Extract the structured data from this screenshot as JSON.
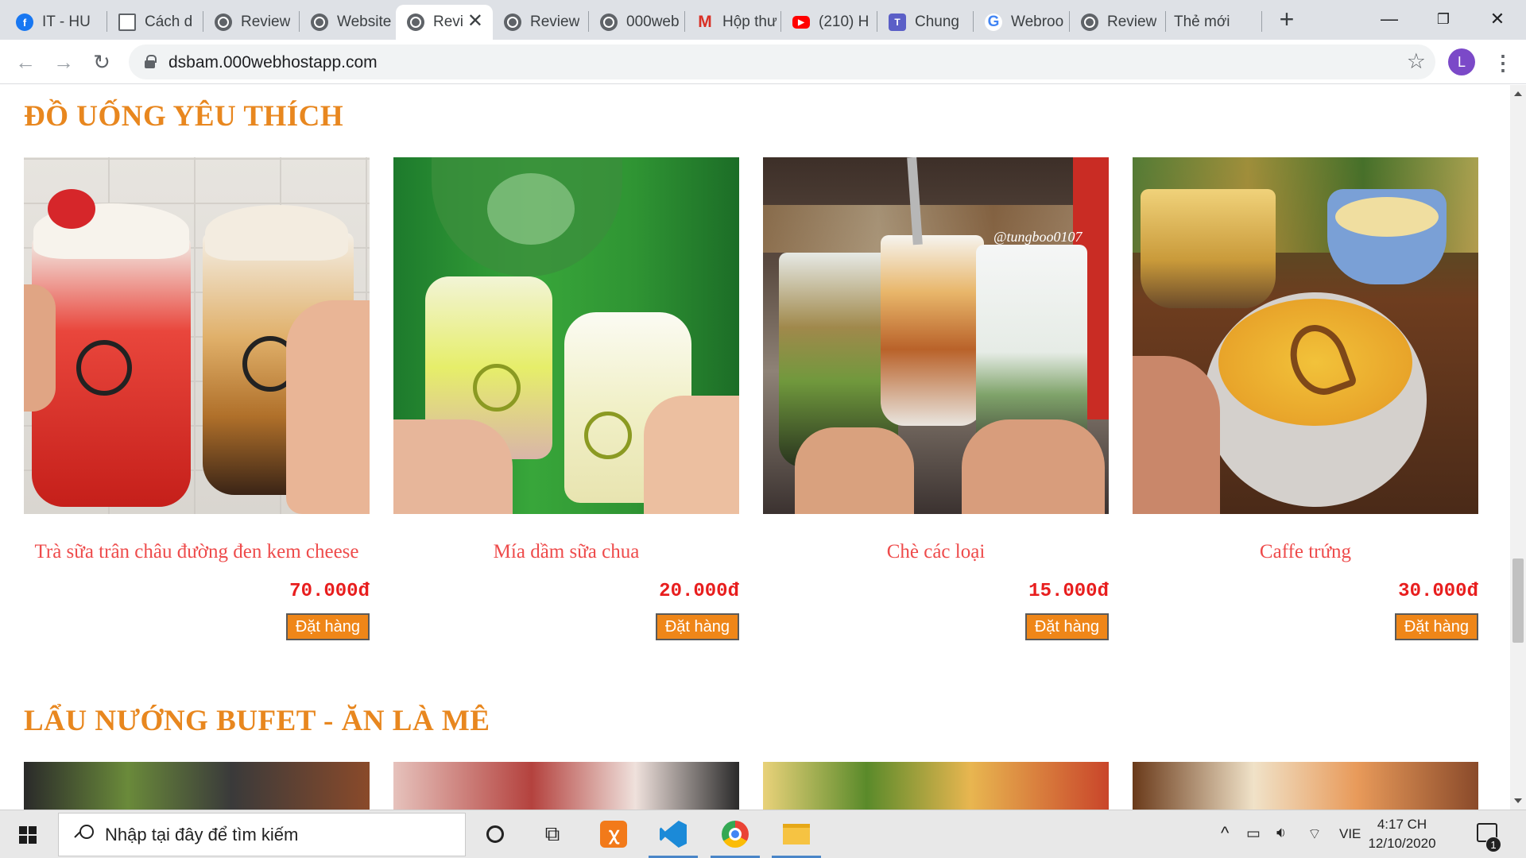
{
  "browser": {
    "tabs": [
      {
        "label": "IT - HU",
        "icon": "facebook-icon"
      },
      {
        "label": "Cách d",
        "icon": "doc-icon"
      },
      {
        "label": "Review",
        "icon": "globe-icon"
      },
      {
        "label": "Website",
        "icon": "globe-icon"
      },
      {
        "label": "Revi",
        "icon": "globe-icon",
        "active": true
      },
      {
        "label": "Review",
        "icon": "globe-icon"
      },
      {
        "label": "000web",
        "icon": "globe-icon"
      },
      {
        "label": "Hộp thư",
        "icon": "gmail-icon"
      },
      {
        "label": "(210) H",
        "icon": "youtube-icon"
      },
      {
        "label": "Chung",
        "icon": "teams-icon"
      },
      {
        "label": "Webroo",
        "icon": "google-icon"
      },
      {
        "label": "Review",
        "icon": "globe-icon"
      },
      {
        "label": "Thẻ mới",
        "icon": ""
      }
    ],
    "url": "dsbam.000webhostapp.com",
    "profile_initial": "L"
  },
  "page": {
    "drinks_section": {
      "title": "ĐỒ UỐNG YÊU THÍCH",
      "items": [
        {
          "name": "Trà sữa trân châu đường đen kem cheese",
          "price": "70.000đ",
          "button": "Đặt hàng"
        },
        {
          "name": "Mía dầm sữa chua",
          "price": "20.000đ",
          "button": "Đặt hàng"
        },
        {
          "name": "Chè các loại",
          "price": "15.000đ",
          "button": "Đặt hàng"
        },
        {
          "name": "Caffe trứng",
          "price": "30.000đ",
          "button": "Đặt hàng"
        }
      ]
    },
    "hotpot_section": {
      "title": "LẨU NƯỚNG BUFET - ĂN LÀ MÊ"
    }
  },
  "taskbar": {
    "search_placeholder": "Nhập tại đây để tìm kiếm",
    "language": "VIE",
    "time": "4:17 CH",
    "date": "12/10/2020",
    "notification_count": "1"
  },
  "colors": {
    "section_title": "#e8871f",
    "product_name": "#ee4b4b",
    "price": "#e81e1e",
    "order_button": "#ef8618"
  }
}
